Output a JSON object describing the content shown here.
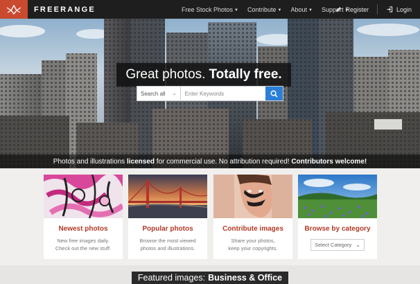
{
  "nav": {
    "brand": "FREERANGE",
    "menu": [
      {
        "label": "Free Stock Photos"
      },
      {
        "label": "Contribute"
      },
      {
        "label": "About"
      },
      {
        "label": "Support"
      }
    ],
    "register_label": "Register",
    "login_label": "Login"
  },
  "hero": {
    "title_regular": "Great photos.",
    "title_bold": "Totally free.",
    "search": {
      "scope": "Search all",
      "placeholder": "Enter Keywords"
    },
    "caption": {
      "part1": "Photos and illustrations",
      "part2": "licensed",
      "part3": "for commercial use. No attribution required!",
      "part4": "Contributors welcome!"
    }
  },
  "cards": [
    {
      "title": "Newest photos",
      "desc1": "New free images daily.",
      "desc2": "Check out the new stuff."
    },
    {
      "title": "Popular photos",
      "desc1": "Browse the most viewed",
      "desc2": "photos and illustrations."
    },
    {
      "title": "Contribute images",
      "desc1": "Share your photos,",
      "desc2": "keep your copyrights."
    },
    {
      "title": "Browse by category",
      "select": "Select Category"
    }
  ],
  "featured": {
    "prefix": "Featured images:",
    "category": "Business & Office"
  },
  "colors": {
    "brand": "#c94a2f",
    "nav_bg": "#1e1e1e",
    "card_title": "#b03a26",
    "search_button": "#2b7fd8"
  }
}
